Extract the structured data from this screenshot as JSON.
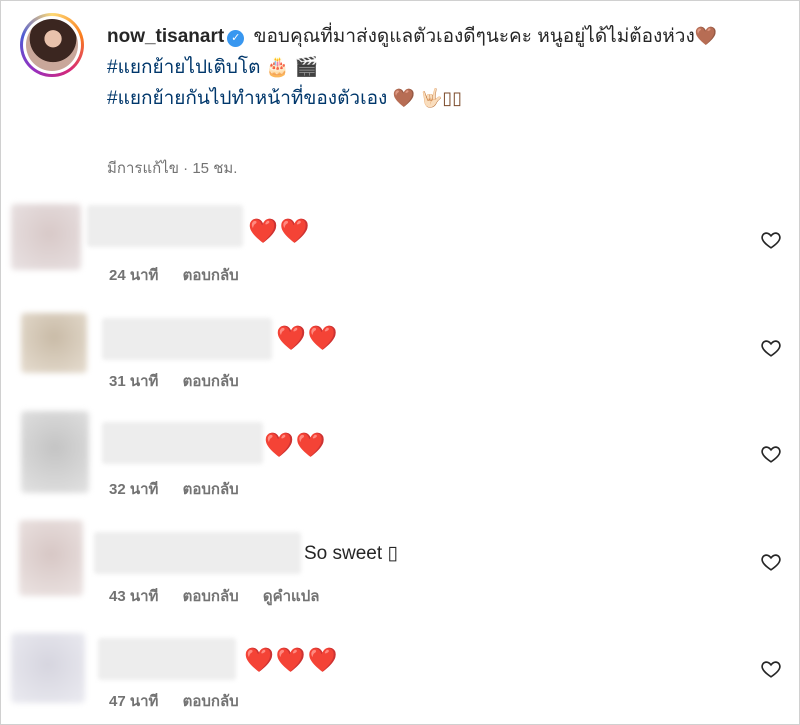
{
  "caption": {
    "username": "now_tisanart",
    "text": "ขอบคุณที่มาส่งดูแลตัวเองดีๆนะคะ หนูอยู่ได้ไม่ต้องห่วง",
    "text_emoji": "🤎",
    "hashtag1": "#แยกย้ายไปเติบโต",
    "hashtag1_emoji": "🎂 🎬",
    "hashtag2": "#แยกย้ายกันไปทำหน้าที่ของตัวเอง",
    "hashtag2_emoji": "🤎 🤟🏻▯▯",
    "edited_label": "มีการแก้ไข",
    "separator": "·",
    "time": "15 ชม."
  },
  "comments": [
    {
      "text": "❤️❤️",
      "time": "24 นาที",
      "reply": "ตอบกลับ"
    },
    {
      "text": "❤️❤️",
      "time": "31 นาที",
      "reply": "ตอบกลับ"
    },
    {
      "text": "❤️❤️",
      "time": "32 นาที",
      "reply": "ตอบกลับ"
    },
    {
      "text": "So sweet ▯",
      "time": "43 นาที",
      "reply": "ตอบกลับ",
      "translate": "ดูคำแปล"
    },
    {
      "text": "❤️❤️❤️",
      "time": "47 นาที",
      "reply": "ตอบกลับ"
    }
  ],
  "icons": {
    "verified": "verified-badge-icon",
    "like": "heart-outline-icon"
  },
  "colors": {
    "hashtag": "#00376b",
    "verified": "#3897f0",
    "meta": "#737373",
    "heart": "#e0193c"
  }
}
